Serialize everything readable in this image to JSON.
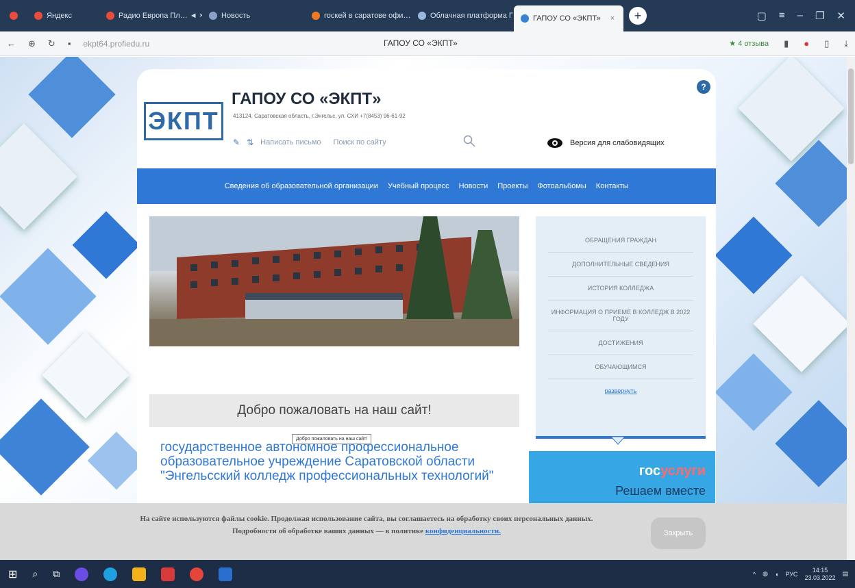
{
  "browser": {
    "tabs": [
      {
        "label": "Яндекс",
        "fav_color": "#e94b3c"
      },
      {
        "label": "Радио Европа Пл… ◄ ×",
        "fav_color": "#e94b3c"
      },
      {
        "label": "Новость",
        "fav_color": "#8aa0c8"
      },
      {
        "label": "госкей в саратове офи…",
        "fav_color": "#f07a22"
      },
      {
        "label": "Облачная платформа Г…",
        "fav_color": "#9bb7de"
      },
      {
        "label": "ГАПОУ СО «ЭКПТ»",
        "fav_color": "#3b82d0",
        "active": true
      }
    ],
    "url": "ekpt64.profiedu.ru",
    "page_title": "ГАПОУ СО «ЭКПТ»",
    "reviews": "★ 4 отзыва"
  },
  "site": {
    "logo": "ЭКПТ",
    "title": "ГАПОУ СО «ЭКПТ»",
    "address": "413124, Саратовская область, г.Энгельс, ул. СХИ      +7(8453) 96-61-92",
    "write_letter": "Написать письмо",
    "search_placeholder": "Поиск по сайту",
    "low_vision": "Версия для слабовидящих",
    "help": "?",
    "nav": [
      "Сведения об образовательной организации",
      "Учебный процесс",
      "Новости",
      "Проекты",
      "Фотоальбомы",
      "Контакты"
    ],
    "welcome": "Добро пожаловать на наш сайт!",
    "tooltip": "Добро пожаловать на наш сайт!",
    "org_name": "государственное автономное профессиональное образовательное учреждение Саратовской области \"Энгельсский колледж профессиональных технологий\"",
    "side_menu": [
      "Обращения граждан",
      "Дополнительные сведения",
      "История колледжа",
      "Информация о приеме в колледж в 2022 году",
      "Достижения",
      "Обучающимся"
    ],
    "side_more": "развернуть",
    "gos_brand_a": "гос",
    "gos_brand_b": "услуги",
    "gos_slogan": "Решаем вместе"
  },
  "cookie": {
    "text": "На сайте используются файлы cookie. Продолжая использование сайта, вы соглашаетесь на обработку своих персональных данных. Подробности об обработке ваших данных — в политике",
    "link": "конфиденциальности.",
    "button": "Закрыть"
  },
  "taskbar": {
    "lang": "РУС",
    "time": "14:15",
    "date": "23.03.2022"
  },
  "colors": {
    "nav": "#2f78d6",
    "brand": "#2f6aa8",
    "taskbar": "#1e2d46"
  }
}
